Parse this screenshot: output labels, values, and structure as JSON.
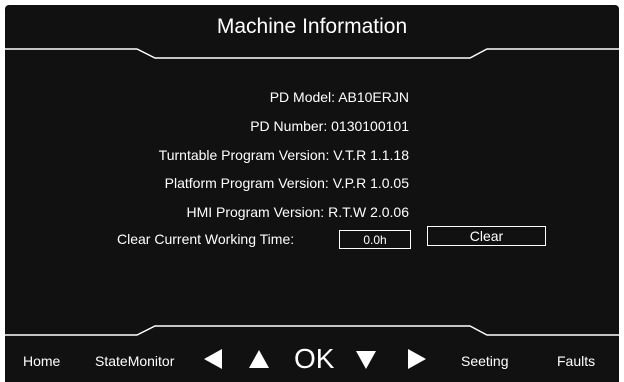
{
  "header": {
    "title": "Machine Information"
  },
  "info": {
    "pd_model": {
      "label": "PD Model:",
      "value": "AB10ERJN"
    },
    "pd_number": {
      "label": "PD Number:",
      "value": "0130100101"
    },
    "turntable_version": {
      "label": "Turntable Program Version:",
      "value": "V.T.R 1.1.18"
    },
    "platform_version": {
      "label": "Platform Program Version:",
      "value": "V.P.R 1.0.05"
    },
    "hmi_version": {
      "label": "HMI Program Version:",
      "value": "R.T.W 2.0.06"
    }
  },
  "working_time": {
    "label": "Clear Current Working Time:",
    "value": "0.0h",
    "clear_label": "Clear"
  },
  "nav": {
    "home": "Home",
    "state_monitor": "StateMonitor",
    "ok": "OK",
    "seeting": "Seeting",
    "faults": "Faults"
  },
  "icons": {
    "left": "left-arrow-icon",
    "up": "up-arrow-icon",
    "down": "down-arrow-icon",
    "right": "right-arrow-icon"
  },
  "colors": {
    "background": "#111111",
    "foreground": "#ffffff"
  }
}
